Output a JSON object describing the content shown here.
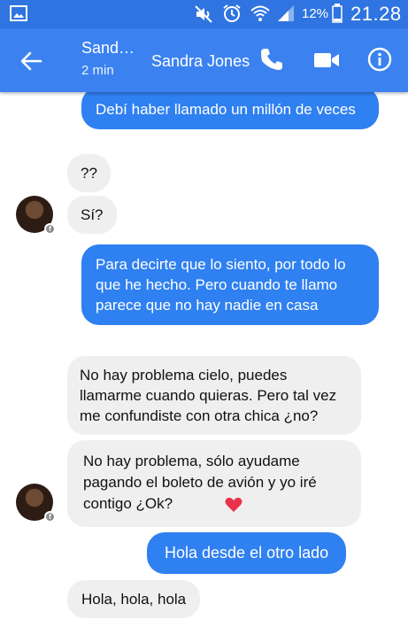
{
  "status_bar": {
    "battery_percent": "12%",
    "time": "21.28",
    "icons": [
      "gallery-icon",
      "mute-icon",
      "alarm-icon",
      "wifi-icon",
      "signal-icon",
      "battery-icon"
    ]
  },
  "header": {
    "contact_short": "Sand…",
    "status": "2 min",
    "contact_name": "Sandra Jones",
    "icons": [
      "back-arrow-icon",
      "phone-icon",
      "video-camera-icon",
      "info-icon"
    ]
  },
  "colors": {
    "status_bar": "#2f74e0",
    "header": "#3b82f0",
    "outgoing_bubble": "#2f80f0",
    "incoming_bubble": "#efefef",
    "heart": "#e8334a"
  },
  "messages": [
    {
      "direction": "outgoing",
      "text": "Debí haber llamado un millón de veces"
    },
    {
      "direction": "incoming",
      "text": "??"
    },
    {
      "direction": "incoming",
      "text": "Sí?"
    },
    {
      "direction": "outgoing",
      "text": "Para decirte que lo siento, por todo lo que he hecho. Pero cuando te llamo parece que no hay nadie en casa"
    },
    {
      "direction": "incoming",
      "text": "No hay problema cielo, puedes llamarme cuando quieras. Pero tal vez me confundiste con otra chica ¿no?"
    },
    {
      "direction": "incoming",
      "text": "No hay problema, sólo ayudame pagando el boleto de avión y yo iré contigo ¿Ok?",
      "emoji": "heart-icon"
    },
    {
      "direction": "outgoing",
      "text": "Hola desde el otro lado"
    },
    {
      "direction": "incoming",
      "text": "Hola, hola, hola"
    }
  ]
}
